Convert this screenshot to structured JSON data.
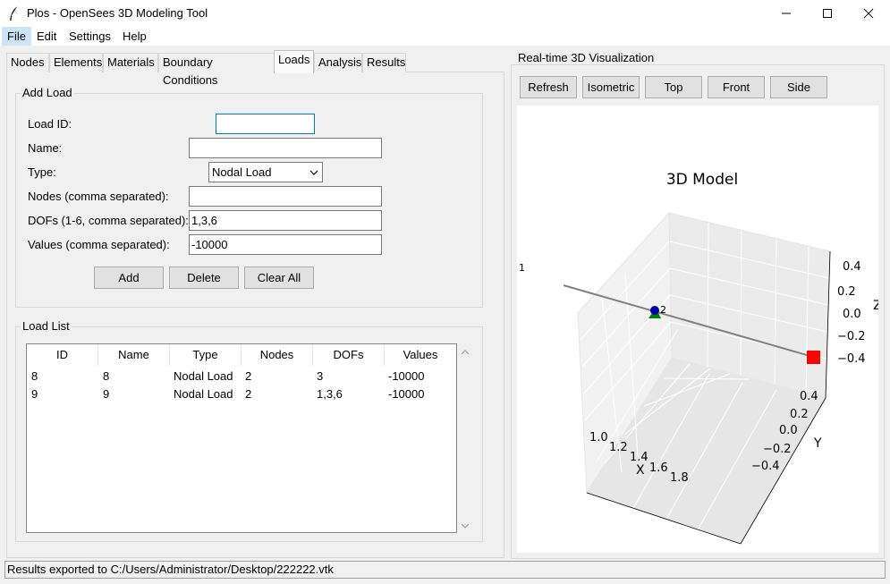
{
  "window": {
    "title": "Plos - OpenSees 3D Modeling Tool",
    "icon": "feather-icon"
  },
  "menu": {
    "file": "File",
    "edit": "Edit",
    "settings": "Settings",
    "help": "Help"
  },
  "tabs": {
    "nodes": "Nodes",
    "elements": "Elements",
    "materials": "Materials",
    "boundary_conditions": "Boundary Conditions",
    "loads": "Loads",
    "analysis": "Analysis",
    "results": "Results",
    "active": "Loads"
  },
  "add_load": {
    "title": "Add Load",
    "load_id_label": "Load ID:",
    "load_id_value": "",
    "name_label": "Name:",
    "name_value": "",
    "type_label": "Type:",
    "type_value": "Nodal Load",
    "nodes_label": "Nodes (comma separated):",
    "nodes_value": "",
    "dofs_label": "DOFs (1-6, comma separated):",
    "dofs_value": "1,3,6",
    "values_label": "Values (comma separated):",
    "values_value": "-10000",
    "add_button": "Add",
    "delete_button": "Delete",
    "clear_all_button": "Clear All"
  },
  "load_list": {
    "title": "Load List",
    "columns": {
      "id": "ID",
      "name": "Name",
      "type": "Type",
      "nodes": "Nodes",
      "dofs": "DOFs",
      "values": "Values"
    },
    "rows": [
      {
        "id": "8",
        "name": "8",
        "type": "Nodal Load",
        "nodes": "2",
        "dofs": "3",
        "values": "-10000"
      },
      {
        "id": "9",
        "name": "9",
        "type": "Nodal Load",
        "nodes": "2",
        "dofs": "1,3,6",
        "values": "-10000"
      }
    ]
  },
  "visualization": {
    "title": "Real-time 3D Visualization",
    "refresh_button": "Refresh",
    "isometric_button": "Isometric",
    "top_button": "Top",
    "front_button": "Front",
    "side_button": "Side"
  },
  "chart_data": {
    "type": "scatter",
    "title": "3D Model",
    "xlabel": "X",
    "ylabel": "Y",
    "zlabel": "Z",
    "x_ticks": [
      "1.0",
      "1.2",
      "1.4",
      "1.6",
      "1.8"
    ],
    "y_ticks": [
      "−0.4",
      "−0.2",
      "0.0",
      "0.2",
      "0.4"
    ],
    "z_ticks": [
      "−0.4",
      "−0.2",
      "0.0",
      "0.2",
      "0.4"
    ],
    "node_labels": [
      "1",
      "2"
    ],
    "colors": {
      "element": "#808080",
      "fixed_support": "#008000",
      "load_marker": "#ff0000",
      "node": "#0000aa"
    },
    "grid": true
  },
  "status": {
    "text": "Results exported to C:/Users/Administrator/Desktop/222222.vtk"
  }
}
